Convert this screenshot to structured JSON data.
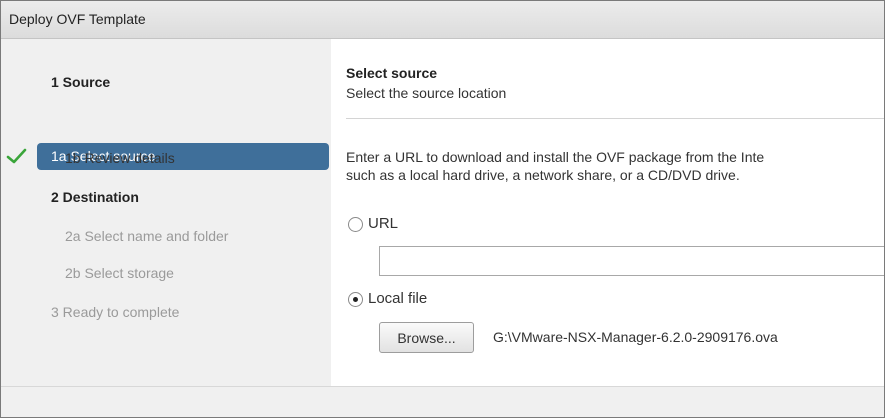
{
  "window": {
    "title": "Deploy OVF Template"
  },
  "sidebar": {
    "steps": [
      {
        "label": "1  Source",
        "state": "section"
      },
      {
        "label": "1a  Select source",
        "state": "active",
        "completed": true
      },
      {
        "label": "1b  Review details",
        "state": "sub"
      },
      {
        "label": "2  Destination",
        "state": "section"
      },
      {
        "label": "2a  Select name and folder",
        "state": "disabled"
      },
      {
        "label": "2b  Select storage",
        "state": "disabled"
      },
      {
        "label": "3  Ready to complete",
        "state": "disabled"
      }
    ],
    "icons": {
      "completed": "checkmark-icon"
    },
    "colors": {
      "active_bg": "#3f6f9a",
      "check": "#3aa53a"
    }
  },
  "main": {
    "title": "Select source",
    "subtitle": "Select the source location",
    "description": [
      "Enter a URL to download and install the OVF package from the Inte",
      "such as a local hard drive, a network share, or a CD/DVD drive."
    ],
    "options": {
      "url": {
        "label": "URL",
        "selected": false,
        "value": ""
      },
      "local_file": {
        "label": "Local file",
        "selected": true
      }
    },
    "browse_label": "Browse...",
    "file_path": "G:\\VMware-NSX-Manager-6.2.0-2909176.ova"
  }
}
